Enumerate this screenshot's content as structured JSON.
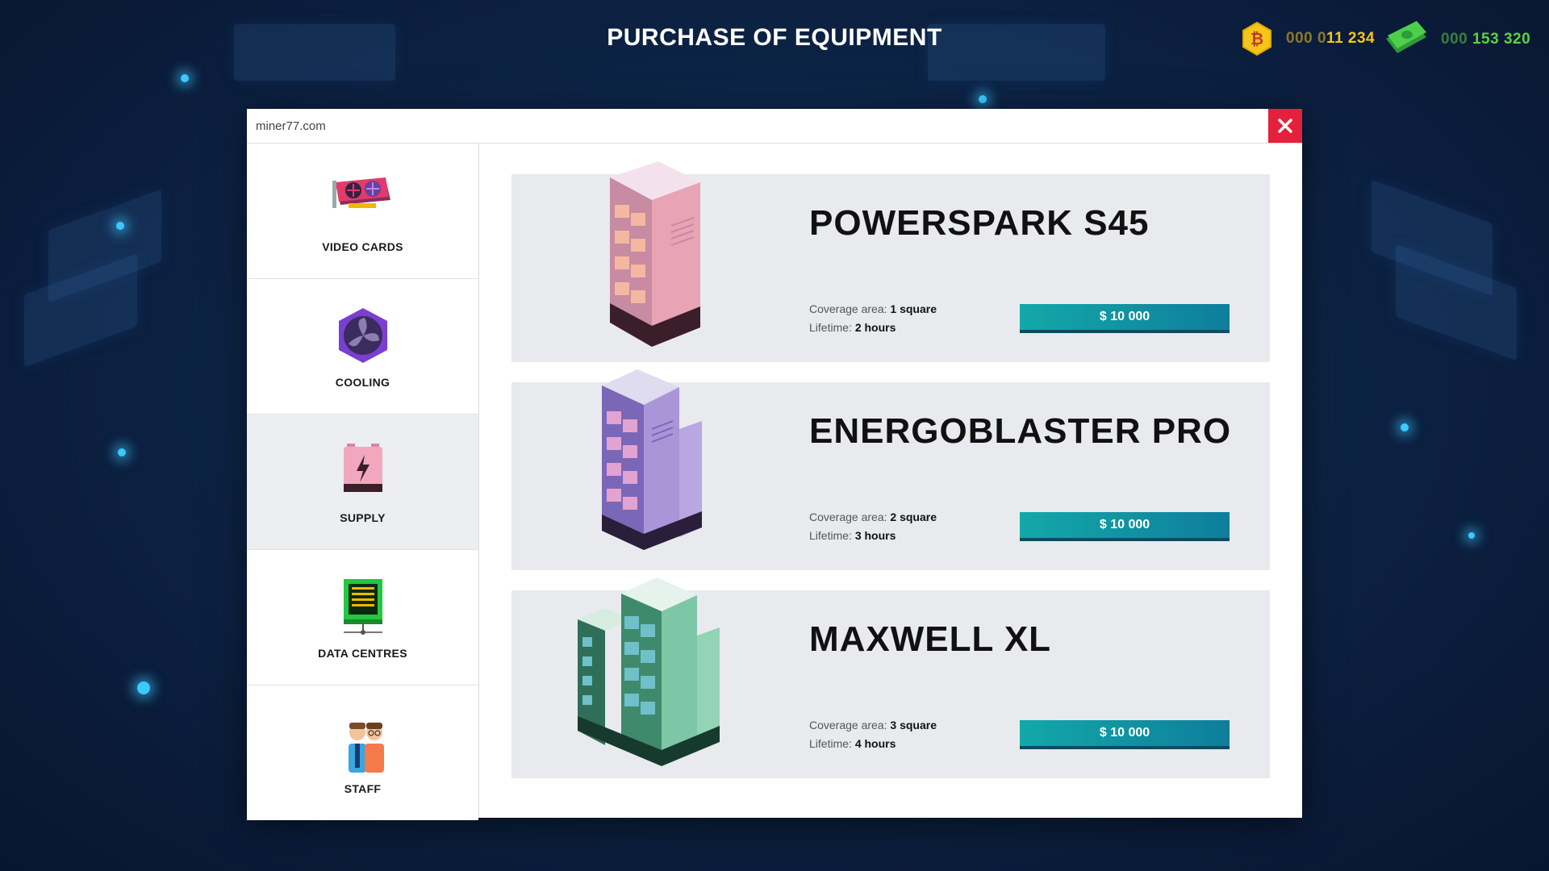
{
  "header": {
    "title": "PURCHASE OF EQUIPMENT",
    "btc": {
      "prefix": "000 0",
      "value": "11 234",
      "icon": "bitcoin-coin-icon",
      "color": "#f5c518"
    },
    "cash": {
      "prefix": "000",
      "value": "153 320",
      "icon": "cash-bundle-icon",
      "color": "#5cd43c"
    }
  },
  "window": {
    "url": "miner77.com",
    "close_icon": "close-icon",
    "accent": "#e5203a"
  },
  "sidebar": {
    "items": [
      {
        "label": "VIDEO CARDS",
        "icon": "video-card-icon",
        "active": false
      },
      {
        "label": "COOLING",
        "icon": "fan-icon",
        "active": false
      },
      {
        "label": "SUPPLY",
        "icon": "power-supply-icon",
        "active": true
      },
      {
        "label": "DATA CENTRES",
        "icon": "server-board-icon",
        "active": false
      },
      {
        "label": "STAFF",
        "icon": "staff-icon",
        "active": false
      }
    ]
  },
  "products": [
    {
      "name": "POWERSPARK S45",
      "coverage_label": "Coverage area:",
      "coverage_value": "1 square",
      "lifetime_label": "Lifetime:",
      "lifetime_value": "2 hours",
      "price": "$ 10 000",
      "color": "#e8a3b4"
    },
    {
      "name": "ENERGOBLASTER PRO",
      "coverage_label": "Coverage area:",
      "coverage_value": "2 square",
      "lifetime_label": "Lifetime:",
      "lifetime_value": "3 hours",
      "price": "$ 10 000",
      "color": "#a995d8"
    },
    {
      "name": "MAXWELL XL",
      "coverage_label": "Coverage area:",
      "coverage_value": "3 square",
      "lifetime_label": "Lifetime:",
      "lifetime_value": "4 hours",
      "price": "$ 10 000",
      "color": "#7ec7a6"
    }
  ]
}
